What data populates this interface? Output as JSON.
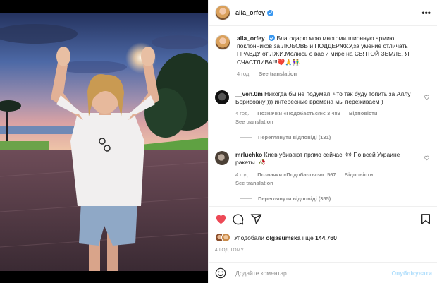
{
  "post": {
    "username": "alla_orfey",
    "more_label": "•••"
  },
  "caption": {
    "username": "alla_orfey",
    "text": "Благодарю мою многомиллионную армию поклонников за ЛЮБОВЬ и ПОДДЕРЖКУ,за умение отличать ПРАВДУ от ЛЖИ.Молюсь о вас и мире на СВЯТОЙ ЗЕМЛЕ. Я СЧАСТЛИВА!!!❤️🙏👫",
    "time": "4 год.",
    "see_translation": "See translation"
  },
  "comments": [
    {
      "username": "__ven.0m",
      "text": "Никогда бы не подумал, что так буду топить за Аллу Борисовну ))) интересные времена мы переживаем )",
      "time": "4 год.",
      "likes": "Позначки «Подобається»: 3 483",
      "reply": "Відповісти",
      "see_translation": "See translation",
      "replies": "Переглянути відповіді (131)"
    },
    {
      "username": "mrluchko",
      "text": "Киев убивают прямо сейчас. 😢 По всей Украине ракеты. 🥀",
      "time": "4 год.",
      "likes": "Позначки «Подобається»: 567",
      "reply": "Відповісти",
      "see_translation": "See translation",
      "replies": "Переглянути відповіді (355)"
    }
  ],
  "likes_bar": {
    "prefix": "Уподобали",
    "user": "olgasumska",
    "suffix": "і ще",
    "count": "144,760"
  },
  "posted_ago": "4 ГОД ТОМУ",
  "comment_box": {
    "placeholder": "Додайте коментар...",
    "publish": "Опублікувати"
  },
  "colors": {
    "like_red": "#ed4956",
    "link_blue": "#b2dffc",
    "verified_blue": "#3897f0"
  },
  "icons": [
    "emoji-icon",
    "heart-icon",
    "comment-icon",
    "share-icon",
    "save-icon",
    "more-icon",
    "verified-icon"
  ]
}
